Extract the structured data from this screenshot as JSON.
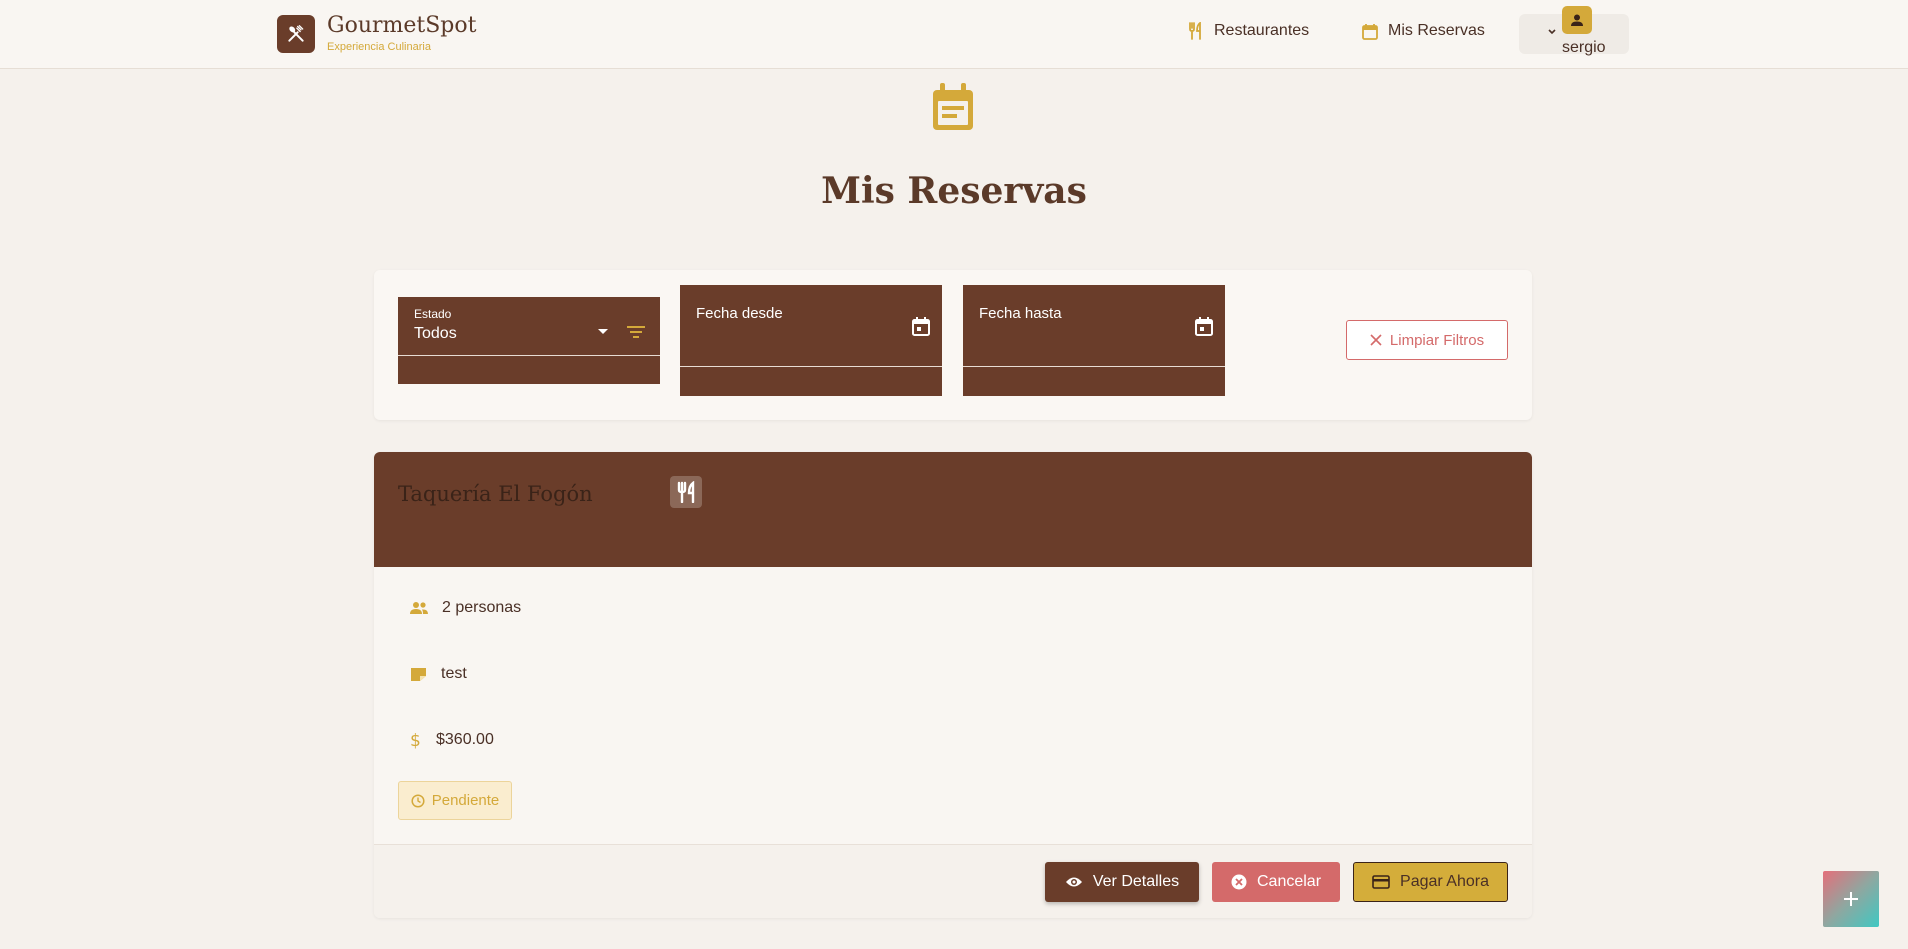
{
  "header": {
    "brand_name": "GourmetSpot",
    "brand_subtitle": "Experiencia Culinaria",
    "nav": [
      {
        "label": "Restaurantes",
        "icon": "fork-knife-icon"
      },
      {
        "label": "Mis Reservas",
        "icon": "calendar-icon"
      }
    ],
    "user": {
      "name": "sergio",
      "icon": "person-icon"
    }
  },
  "page": {
    "title": "Mis Reservas",
    "icon": "event-note-icon"
  },
  "filters": {
    "estado_label": "Estado",
    "estado_value": "Todos",
    "fecha_desde_label": "Fecha desde",
    "fecha_hasta_label": "Fecha hasta",
    "clear_label": "Limpiar Filtros"
  },
  "reservation": {
    "restaurant": "Taquería El Fogón",
    "people": "2 personas",
    "note": "test",
    "price": "$360.00",
    "status": "Pendiente",
    "actions": {
      "details": "Ver Detalles",
      "cancel": "Cancelar",
      "pay": "Pagar Ahora"
    }
  },
  "colors": {
    "brown": "#6a3d2a",
    "gold": "#d4a93a",
    "red": "#d46a6a",
    "background": "#f5f1ec"
  }
}
